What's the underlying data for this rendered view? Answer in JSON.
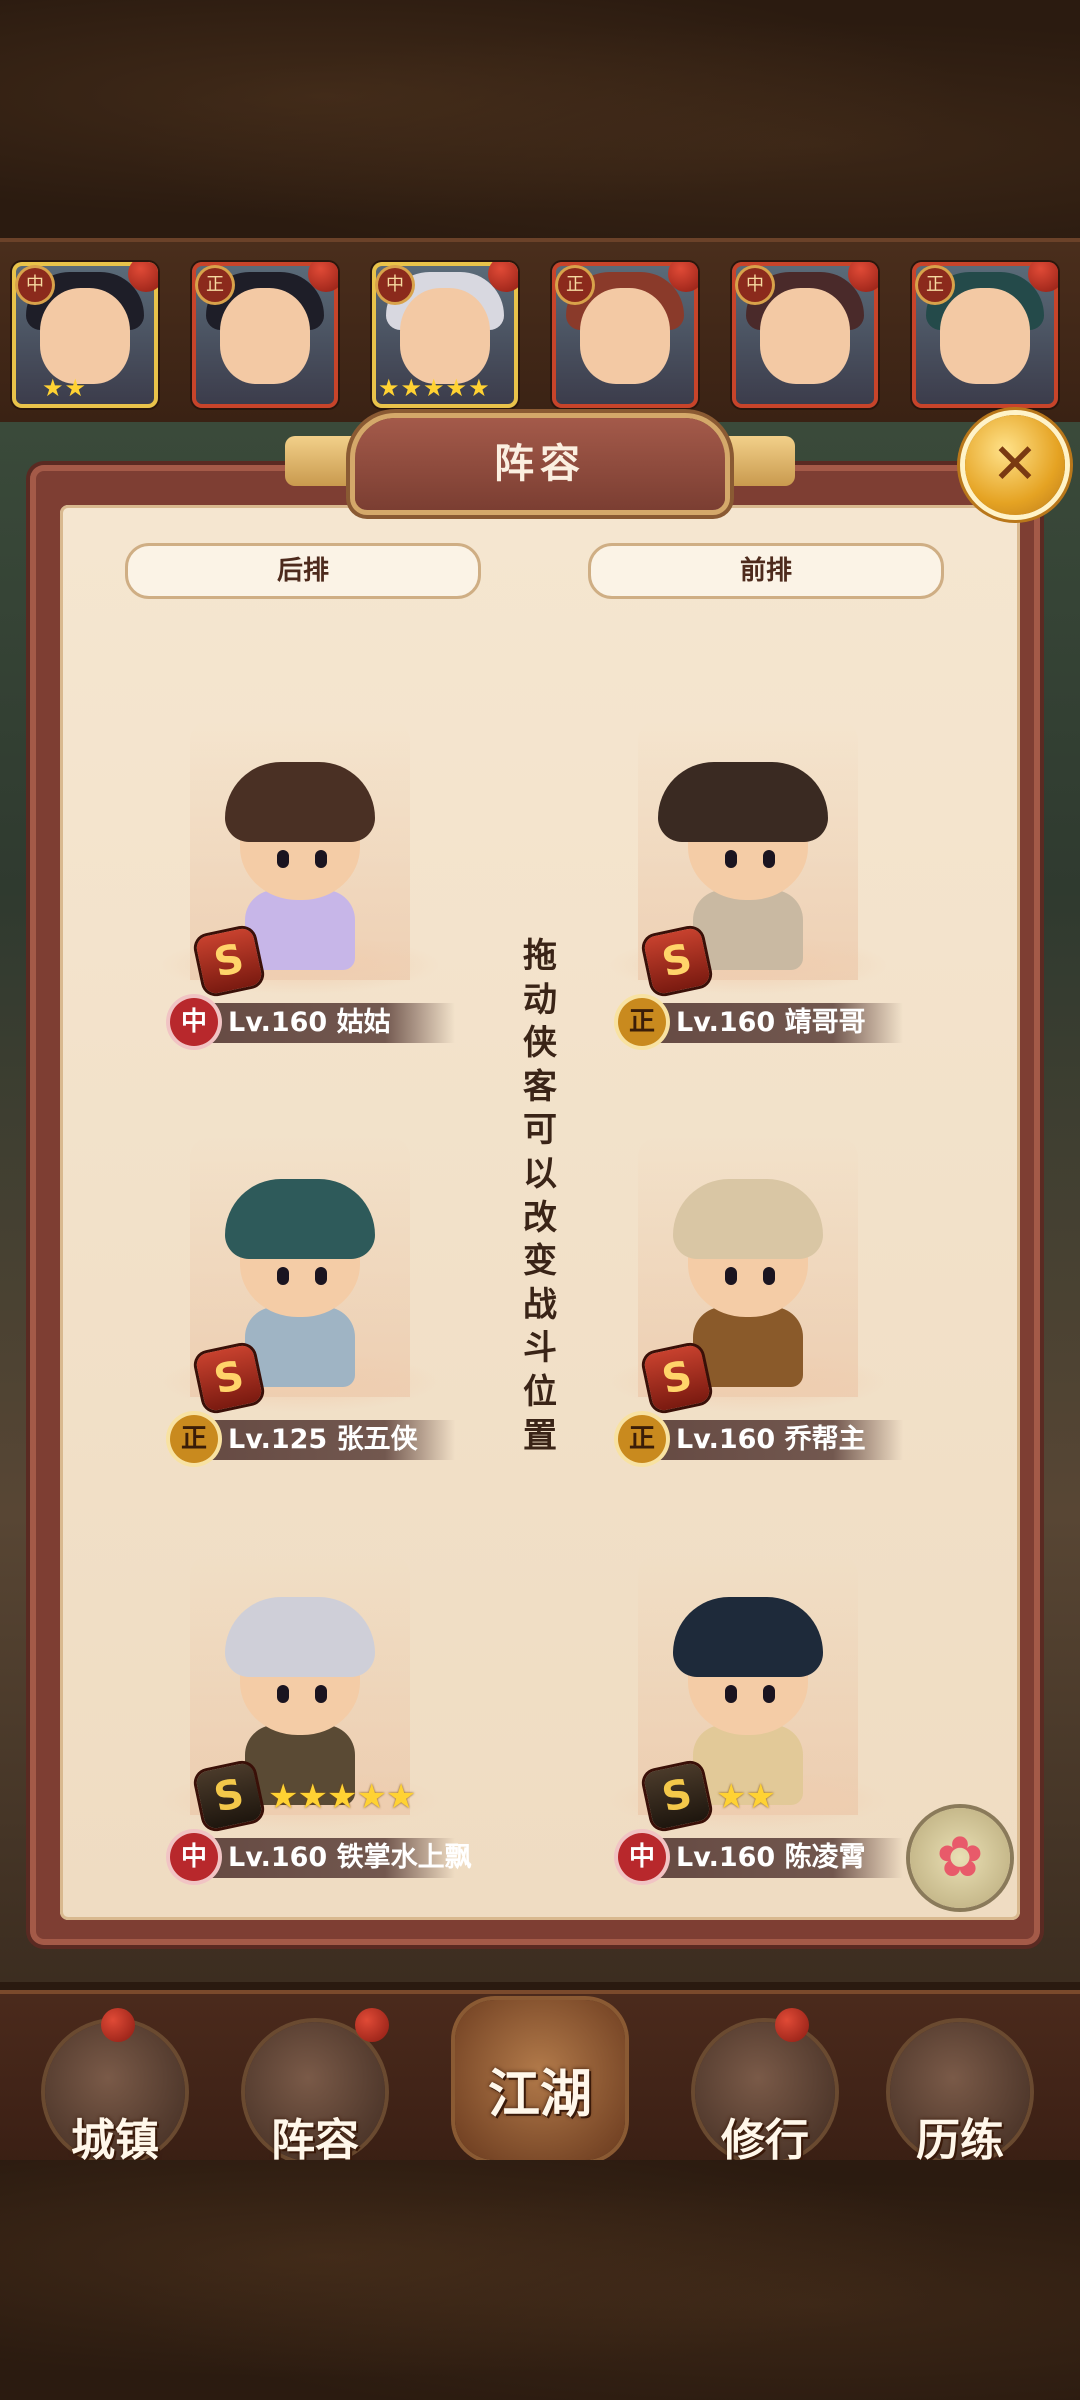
{
  "panel": {
    "title": "阵容",
    "back_row_label": "后排",
    "front_row_label": "前排",
    "hint": "拖动侠客可以改变战斗位置"
  },
  "roster": [
    {
      "alignment": "中",
      "stars": "★★"
    },
    {
      "alignment": "正",
      "stars": ""
    },
    {
      "alignment": "中",
      "stars": "★★★★★"
    },
    {
      "alignment": "正",
      "stars": ""
    },
    {
      "alignment": "中",
      "stars": ""
    },
    {
      "alignment": "正",
      "stars": ""
    }
  ],
  "heroes": [
    {
      "alignment": "中",
      "level": "Lv.160",
      "name": "姑姑",
      "rank": "S",
      "stars": ""
    },
    {
      "alignment": "正",
      "level": "Lv.160",
      "name": "靖哥哥",
      "rank": "S",
      "stars": ""
    },
    {
      "alignment": "正",
      "level": "Lv.125",
      "name": "张五侠",
      "rank": "S",
      "stars": ""
    },
    {
      "alignment": "正",
      "level": "Lv.160",
      "name": "乔帮主",
      "rank": "S",
      "stars": ""
    },
    {
      "alignment": "中",
      "level": "Lv.160",
      "name": "铁掌水上飘",
      "rank": "S",
      "stars": "★★★★★"
    },
    {
      "alignment": "中",
      "level": "Lv.160",
      "name": "陈凌霄",
      "rank": "S",
      "stars": "★★"
    }
  ],
  "nav": [
    {
      "label": "城镇"
    },
    {
      "label": "阵容"
    },
    {
      "label": "江湖"
    },
    {
      "label": "修行"
    },
    {
      "label": "历练"
    }
  ],
  "colors": {
    "panel_frame": "#7e3e33",
    "panel_paper": "#f5e6d0",
    "gold": "#e5a323",
    "star": "#ffd233"
  },
  "icons": {
    "close": "close-icon",
    "flower": "flower-icon"
  }
}
